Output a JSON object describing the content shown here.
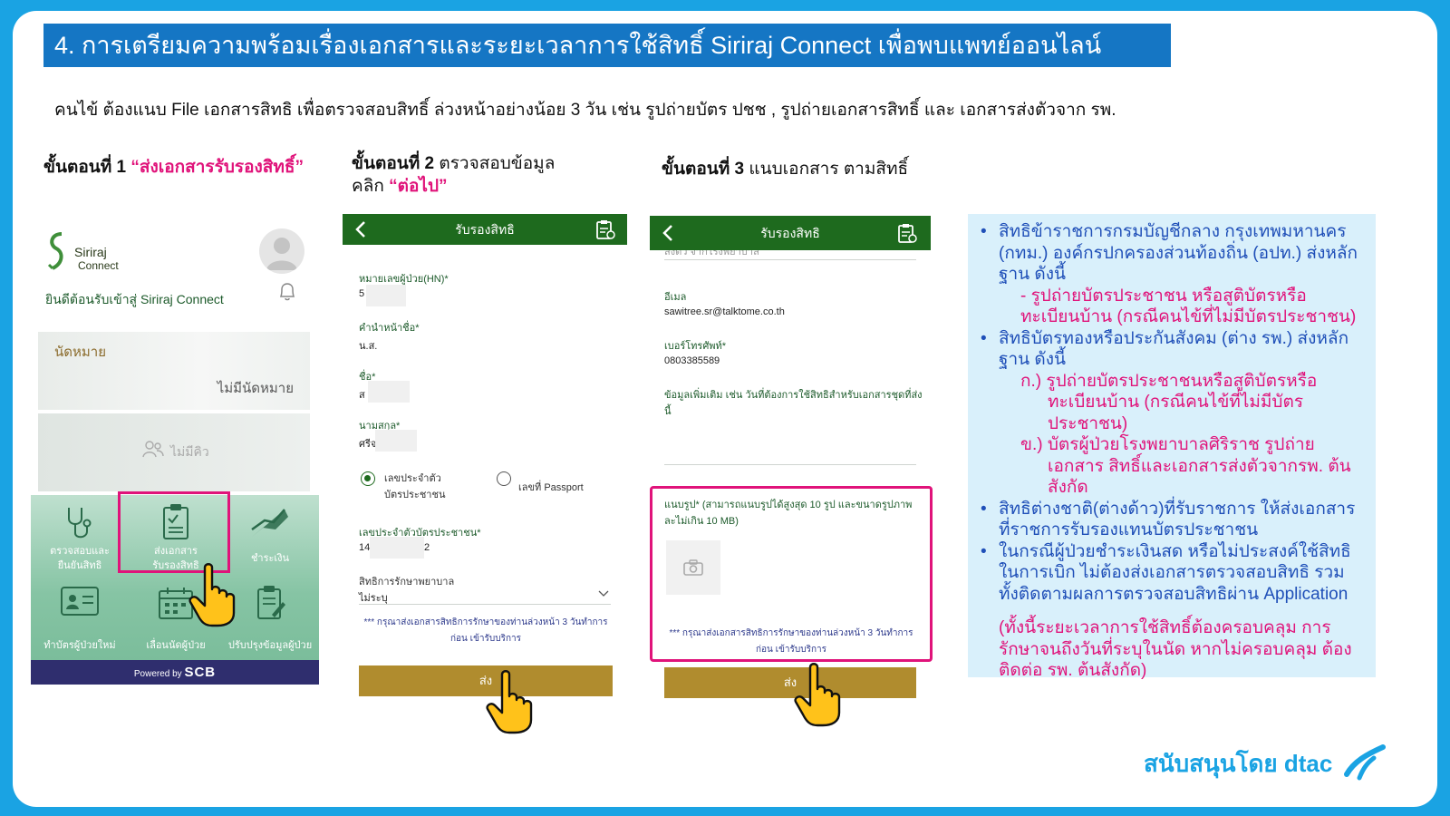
{
  "title": "4. การเตรียมความพร้อมเรื่องเอกสารและระยะเวลาการใช้สิทธิ์ Siriraj Connect เพื่อพบแพทย์ออนไลน์",
  "intro": "คนไข้ ต้องแนบ File เอกสารสิทธิ เพื่อตรวจสอบสิทธิ์ ล่วงหน้าอย่างน้อย 3 วัน  เช่น รูปถ่ายบัตร ปชช , รูปถ่ายเอกสารสิทธิ์ และ เอกสารส่งตัวจาก รพ.",
  "steps": {
    "step1_label": "ขั้นตอนที่ 1",
    "step1_action": "“ส่งเอกสารรับรองสิทธิ์”",
    "step2_label": "ขั้นตอนที่ 2",
    "step2_text": " ตรวจสอบข้อมูล",
    "step2_click": "คลิก ",
    "step2_action": "“ต่อไป”",
    "step3_label": "ขั้นตอนที่ 3",
    "step3_text": " แนบเอกสาร ตามสิทธิ์"
  },
  "phone1": {
    "brand_line1": "Siriraj",
    "brand_line2": "Connect",
    "welcome": "ยินดีต้อนรับเข้าสู่ Siriraj Connect",
    "appointment_title": "นัดหมาย",
    "appointment_status": "ไม่มีนัดหมาย",
    "queue_status": "ไม่มีคิว",
    "menu": [
      {
        "label": "ตรวจสอบและ\nยืนยันสิทธิ",
        "icon": "stethoscope-icon"
      },
      {
        "label": "ส่งเอกสาร\nรับรองสิทธิ",
        "icon": "clipboard-icon"
      },
      {
        "label": "ชำระเงิน",
        "icon": "payment-icon"
      },
      {
        "label": "ทำบัตรผู้ป่วยใหม่",
        "icon": "id-card-icon"
      },
      {
        "label": "เลื่อนนัดผู้ป่วย",
        "icon": "calendar-icon"
      },
      {
        "label": "ปรับปรุงข้อมูลผู้ป่วย",
        "icon": "edit-doc-icon"
      }
    ],
    "footer_powered": "Powered by",
    "footer_brand": "SCB"
  },
  "phone2": {
    "header": "รับรองสิทธิ",
    "hn_label": "หมายเลขผู้ป่วย(HN)*",
    "hn_value": "5",
    "prefix_label": "คำนำหน้าชื่อ*",
    "prefix_value": "น.ส.",
    "name_label": "ชื่อ*",
    "name_value": "ส",
    "surname_label": "นามสกุล*",
    "surname_value": "ศรีจ",
    "radio_id_line1": "เลขประจำตัว",
    "radio_id_line2": "บัตรประชาชน",
    "radio_passport": "เลขที่ Passport",
    "idcard_label": "เลขประจำตัวบัตรประชาชน*",
    "idcard_value_start": "14",
    "idcard_value_end": "2",
    "rights_label": "สิทธิการรักษาพยาบาล",
    "rights_value": "ไม่ระบุ",
    "note": "*** กรุณาส่งเอกสารสิทธิการรักษาของท่านล่วงหน้า 3 วันทำการก่อน เข้ารับบริการ",
    "send": "ส่ง"
  },
  "phone3": {
    "header": "รับรองสิทธิ",
    "scrolled_text": "ส่งตัว จากโรงพยาบาล",
    "email_label": "อีเมล",
    "email_value": "sawitree.sr@talktome.co.th",
    "phone_label": "เบอร์โทรศัพท์*",
    "phone_value": "0803385589",
    "extra_label": "ข้อมูลเพิ่มเติม เช่น วันที่ต้องการใช้สิทธิสำหรับเอกสารชุดที่ส่งนี้",
    "attach_label": "แนบรูป* (สามารถแนบรูปได้สูงสุด 10 รูป และขนาดรูปภาพละไม่เกิน 10 MB)",
    "note": "*** กรุณาส่งเอกสารสิทธิการรักษาของท่านล่วงหน้า 3 วันทำการก่อน เข้ารับบริการ",
    "send": "ส่ง"
  },
  "info": {
    "b1": "สิทธิข้าราชการกรมบัญชีกลาง กรุงเทพมหานคร (กทม.) องค์กรปกครองส่วนท้องถิ่น (อปท.) ส่งหลักฐาน ดังนี้",
    "b1_sub": "-  รูปถ่ายบัตรประชาชน หรือสูติบัตรหรือ ทะเบียนบ้าน (กรณีคนไข้ที่ไม่มีบัตรประชาชน)",
    "b2": "สิทธิบัตรทองหรือประกันสังคม (ต่าง รพ.) ส่งหลักฐาน ดังนี้",
    "b2_a": "ก.) รูปถ่ายบัตรประชาชนหรือสูติบัตรหรือ ทะเบียนบ้าน (กรณีคนไข้ที่ไม่มีบัตรประชาชน)",
    "b2_b": "ข.) บัตรผู้ป่วยโรงพยาบาลศิริราช รูปถ่ายเอกสาร สิทธิ์และเอกสารส่งตัวจากรพ. ต้นสังกัด",
    "b3": "สิทธิต่างชาติ(ต่างด้าว)ที่รับราชการ ให้ส่งเอกสารที่ราชการรับรองแทนบัตรประชาชน",
    "b4": "ในกรณีผู้ป่วยชำระเงินสด หรือไม่ประสงค์ใช้สิทธิในการเบิก ไม่ต้องส่งเอกสารตรวจสอบสิทธิ รวมทั้งติดตามผลการตรวจสอบสิทธิผ่าน Application",
    "remark": "(ทั้งนี้ระยะเวลาการใช้สิทธิ์ต้องครอบคลุม การรักษาจนถึงวันที่ระบุในนัด หากไม่ครอบคลุม ต้องติดต่อ รพ. ต้นสังกัด)"
  },
  "sponsor": "สนับสนุนโดย dtac",
  "colors": {
    "title_bg": "#1576c4",
    "accent_pink": "#e0137a",
    "app_green": "#1e6a1e",
    "send_gold": "#b08c2e",
    "info_bg": "#d9f0fb",
    "dtac_blue": "#1aa3e3"
  }
}
